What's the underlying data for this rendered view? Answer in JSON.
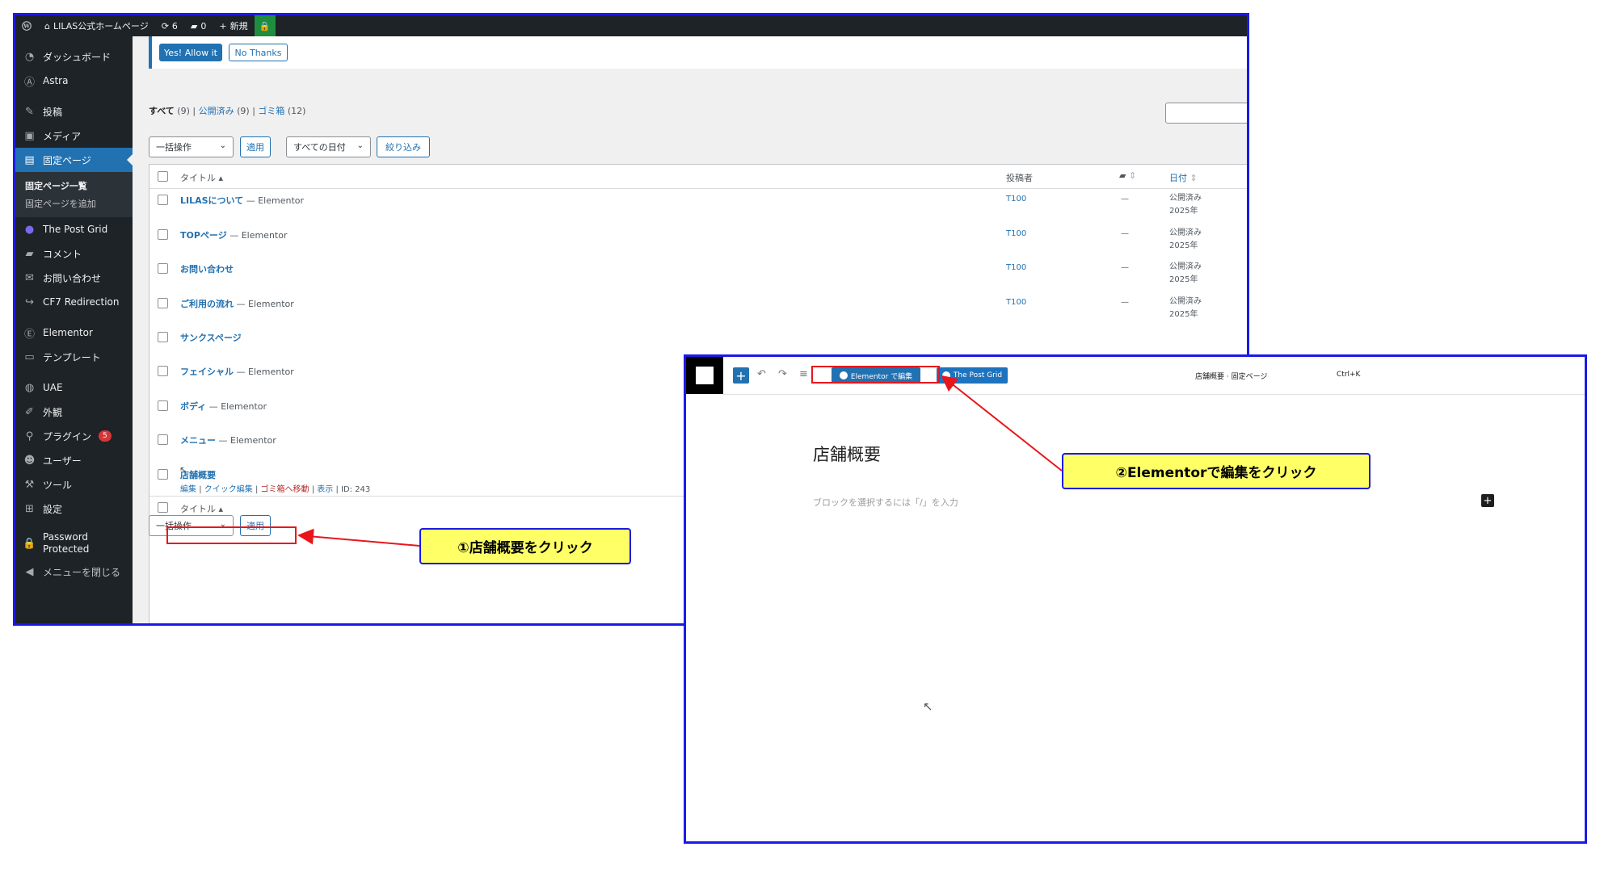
{
  "admin_bar": {
    "wp_icon": "wordpress-icon",
    "site_name": "LILAS公式ホームページ",
    "updates_count": "6",
    "comments_count": "0",
    "new_label": "新規"
  },
  "sidebar": {
    "items": [
      {
        "label": "ダッシュボード",
        "icon": "dashboard-icon"
      },
      {
        "label": "Astra",
        "icon": "astra-icon"
      },
      {
        "label": "投稿",
        "icon": "pin-icon"
      },
      {
        "label": "メディア",
        "icon": "media-icon"
      },
      {
        "label": "固定ページ",
        "icon": "page-icon"
      },
      {
        "label": "The Post Grid",
        "icon": "grid-icon"
      },
      {
        "label": "コメント",
        "icon": "comment-icon"
      },
      {
        "label": "お問い合わせ",
        "icon": "mail-icon"
      },
      {
        "label": "CF7 Redirection",
        "icon": "redirect-icon"
      },
      {
        "label": "Elementor",
        "icon": "elementor-icon"
      },
      {
        "label": "テンプレート",
        "icon": "folder-icon"
      },
      {
        "label": "UAE",
        "icon": "uae-icon"
      },
      {
        "label": "外観",
        "icon": "brush-icon"
      },
      {
        "label": "プラグイン",
        "icon": "plugin-icon",
        "badge": "5"
      },
      {
        "label": "ユーザー",
        "icon": "user-icon"
      },
      {
        "label": "ツール",
        "icon": "wrench-icon"
      },
      {
        "label": "設定",
        "icon": "settings-icon"
      },
      {
        "label": "Password Protected",
        "icon": "lock-icon"
      },
      {
        "label": "メニューを閉じる",
        "icon": "collapse-icon"
      }
    ],
    "submenu": {
      "all_pages": "固定ページ一覧",
      "add_new": "固定ページを追加"
    }
  },
  "notice": {
    "allow": "Yes! Allow it",
    "deny": "No Thanks"
  },
  "filters": {
    "all": "すべて",
    "all_count": "(9)",
    "published": "公開済み",
    "published_count": "(9)",
    "trash": "ゴミ箱",
    "trash_count": "(12)"
  },
  "toolbar": {
    "bulk_action": "一括操作",
    "apply": "適用",
    "date_filter": "すべての日付",
    "filter_button": "絞り込み"
  },
  "table": {
    "columns": {
      "title": "タイトル",
      "author": "投稿者",
      "date": "日付"
    },
    "rows": [
      {
        "title": "LILASについて",
        "suffix": " — Elementor",
        "author": "T100",
        "dash": "—",
        "date1": "公開済み",
        "date2": "2025年"
      },
      {
        "title": "TOPページ",
        "suffix": " — Elementor",
        "author": "T100",
        "dash": "—",
        "date1": "公開済み",
        "date2": "2025年"
      },
      {
        "title": "お問い合わせ",
        "suffix": "",
        "author": "T100",
        "dash": "—",
        "date1": "公開済み",
        "date2": "2025年"
      },
      {
        "title": "ご利用の流れ",
        "suffix": " — Elementor",
        "author": "T100",
        "dash": "—",
        "date1": "公開済み",
        "date2": "2025年"
      },
      {
        "title": "サンクスページ",
        "suffix": ""
      },
      {
        "title": "フェイシャル",
        "suffix": " — Elementor"
      },
      {
        "title": "ボディ",
        "suffix": " — Elementor"
      },
      {
        "title": "メニュー",
        "suffix": " — Elementor"
      },
      {
        "title": "店舗概要",
        "suffix": ""
      }
    ],
    "row_actions": {
      "edit": "編集",
      "quick_edit": "クイック編集",
      "trash": "ゴミ箱へ移動",
      "view": "表示",
      "id": "ID: 243"
    },
    "footer_title": "タイトル"
  },
  "editor": {
    "elementor_button": "Elementor で編集",
    "post_grid_button": "The Post Grid",
    "doc_title": "店舗概要 · 固定ページ",
    "shortcut": "Ctrl+K",
    "page_heading": "店舗概要",
    "block_placeholder": "ブロックを選択するには「/」を入力"
  },
  "annotations": {
    "step1": "①店舗概要をクリック",
    "step2": "②Elementorで編集をクリック",
    "color_highlight": "#e8161b",
    "color_callout": "#ffff66",
    "color_frame": "#1a1ae6"
  }
}
